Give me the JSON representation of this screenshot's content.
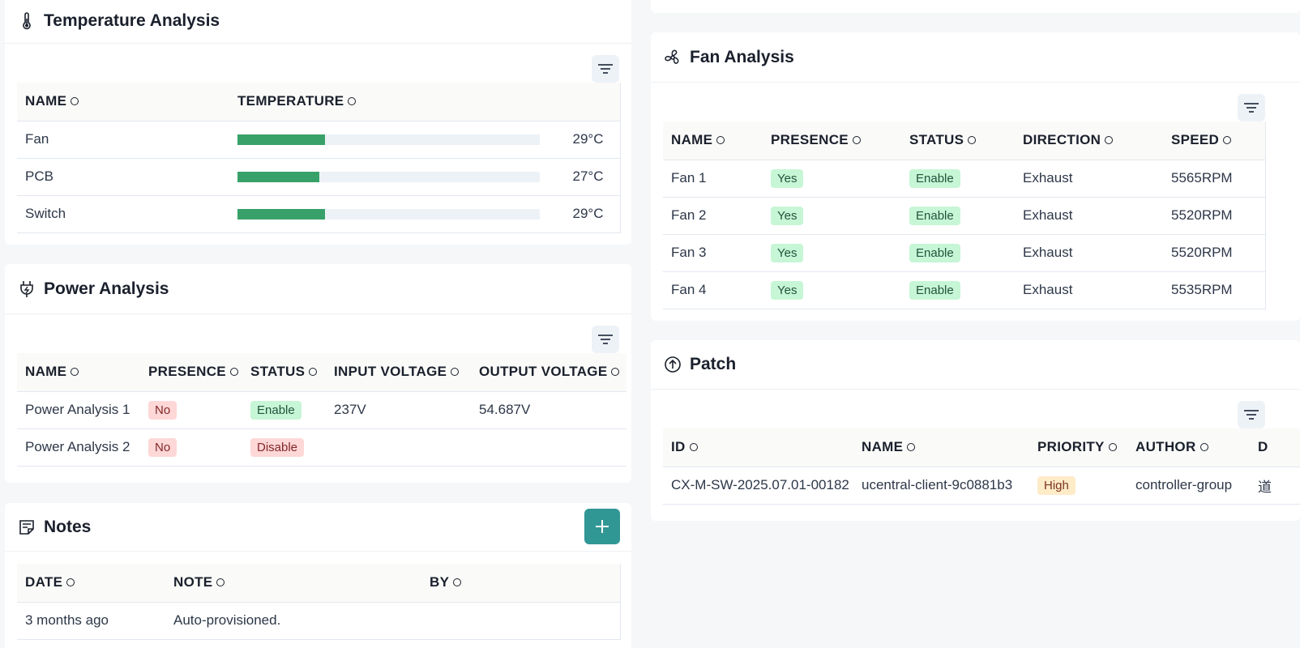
{
  "temperature": {
    "title": "Temperature Analysis",
    "columns": [
      "NAME",
      "TEMPERATURE"
    ],
    "rows": [
      {
        "name": "Fan",
        "value": "29°C",
        "level": 0.29
      },
      {
        "name": "PCB",
        "value": "27°C",
        "level": 0.27
      },
      {
        "name": "Switch",
        "value": "29°C",
        "level": 0.29
      }
    ]
  },
  "power": {
    "title": "Power Analysis",
    "columns": [
      "NAME",
      "PRESENCE",
      "STATUS",
      "INPUT VOLTAGE",
      "OUTPUT VOLTAGE"
    ],
    "rows": [
      {
        "name": "Power Analysis 1",
        "presence": "No",
        "status": "Enable",
        "input": "237V",
        "output": "54.687V"
      },
      {
        "name": "Power Analysis 2",
        "presence": "No",
        "status": "Disable",
        "input": "",
        "output": ""
      }
    ]
  },
  "notes": {
    "title": "Notes",
    "columns": [
      "DATE",
      "NOTE",
      "BY"
    ],
    "rows": [
      {
        "date": "3 months ago",
        "note": "Auto-provisioned.",
        "by": ""
      }
    ]
  },
  "fan": {
    "title": "Fan Analysis",
    "columns": [
      "NAME",
      "PRESENCE",
      "STATUS",
      "DIRECTION",
      "SPEED"
    ],
    "rows": [
      {
        "name": "Fan 1",
        "presence": "Yes",
        "status": "Enable",
        "direction": "Exhaust",
        "speed": "5565RPM"
      },
      {
        "name": "Fan 2",
        "presence": "Yes",
        "status": "Enable",
        "direction": "Exhaust",
        "speed": "5520RPM"
      },
      {
        "name": "Fan 3",
        "presence": "Yes",
        "status": "Enable",
        "direction": "Exhaust",
        "speed": "5520RPM"
      },
      {
        "name": "Fan 4",
        "presence": "Yes",
        "status": "Enable",
        "direction": "Exhaust",
        "speed": "5535RPM"
      }
    ]
  },
  "patch": {
    "title": "Patch",
    "columns": [
      "ID",
      "NAME",
      "PRIORITY",
      "AUTHOR",
      "D"
    ],
    "rows": [
      {
        "id": "CX-M-SW-2025.07.01-00182",
        "name": "ucentral-client-9c0881b3",
        "priority": "High",
        "author": "controller-group",
        "extra": "道"
      }
    ]
  },
  "colors": {
    "bar_fill": "#38a169",
    "accent": "#319795"
  }
}
